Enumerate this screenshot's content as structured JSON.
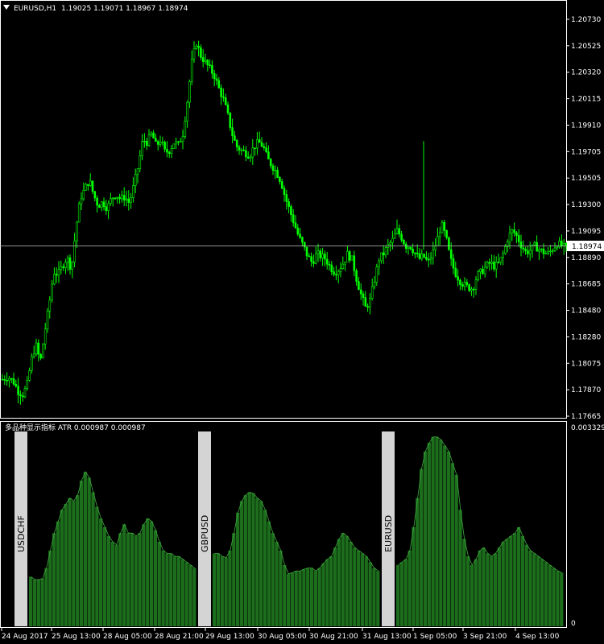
{
  "header": {
    "menu_icon": "triangle-down-icon",
    "symbol_timeframe": "EURUSD,H1",
    "ohlc": "1.19025 1.19071 1.18967 1.18974"
  },
  "colors": {
    "background": "#000000",
    "candle": "#00ff00",
    "price_line": "#c0c0c0",
    "axis": "#ffffff",
    "histogram_fill": "#1c6e1c",
    "histogram_edge": "#3fa83f",
    "symbol_bar": "#d4d4d4"
  },
  "price_axis": {
    "ticks": [
      "1.20730",
      "1.20525",
      "1.20320",
      "1.20115",
      "1.19910",
      "1.19705",
      "1.19505",
      "1.19300",
      "1.19095",
      "1.18890",
      "1.18685",
      "1.18480",
      "1.18280",
      "1.18075",
      "1.17870",
      "1.17665"
    ],
    "current_price": "1.18974"
  },
  "indicator": {
    "title": "多品种显示指标 ATR 0.000987 0.000987",
    "ticks": [
      "0.003329",
      "0"
    ]
  },
  "time_axis": {
    "labels": [
      "24 Aug 2017",
      "25 Aug 13:00",
      "28 Aug 05:00",
      "28 Aug 21:00",
      "29 Aug 13:00",
      "30 Aug 05:00",
      "30 Aug 21:00",
      "31 Aug 13:00",
      "1 Sep 05:00",
      "3 Sep 21:00",
      "4 Sep 13:00"
    ]
  },
  "chart_data": [
    {
      "type": "candlestick",
      "symbol": "EURUSD",
      "timeframe": "H1",
      "ylim": [
        1.17665,
        1.2083
      ],
      "close_path": [
        [
          0,
          1.1795
        ],
        [
          5,
          1.1797
        ],
        [
          10,
          1.1793
        ],
        [
          14,
          1.1786
        ],
        [
          18,
          1.1783
        ],
        [
          22,
          1.179
        ],
        [
          26,
          1.181
        ],
        [
          30,
          1.1822
        ],
        [
          34,
          1.1808
        ],
        [
          38,
          1.1832
        ],
        [
          42,
          1.1853
        ],
        [
          46,
          1.1878
        ],
        [
          50,
          1.1876
        ],
        [
          54,
          1.1883
        ],
        [
          58,
          1.1889
        ],
        [
          62,
          1.188
        ],
        [
          66,
          1.1912
        ],
        [
          70,
          1.1935
        ],
        [
          74,
          1.1942
        ],
        [
          78,
          1.1949
        ],
        [
          82,
          1.1937
        ],
        [
          86,
          1.1929
        ],
        [
          90,
          1.1932
        ],
        [
          94,
          1.1927
        ],
        [
          98,
          1.1935
        ],
        [
          102,
          1.1938
        ],
        [
          106,
          1.1934
        ],
        [
          110,
          1.1936
        ],
        [
          114,
          1.1931
        ],
        [
          118,
          1.1945
        ],
        [
          122,
          1.196
        ],
        [
          126,
          1.198
        ],
        [
          130,
          1.1978
        ],
        [
          134,
          1.1985
        ],
        [
          138,
          1.1975
        ],
        [
          142,
          1.198
        ],
        [
          146,
          1.197
        ],
        [
          150,
          1.1972
        ],
        [
          154,
          1.1978
        ],
        [
          158,
          1.1976
        ],
        [
          162,
          1.1985
        ],
        [
          166,
          1.201
        ],
        [
          170,
          1.204
        ],
        [
          174,
          1.2055
        ],
        [
          178,
          1.2045
        ],
        [
          182,
          1.204
        ],
        [
          186,
          1.2035
        ],
        [
          190,
          1.203
        ],
        [
          194,
          1.202
        ],
        [
          198,
          1.2012
        ],
        [
          202,
          1.2
        ],
        [
          206,
          1.1985
        ],
        [
          210,
          1.1975
        ],
        [
          214,
          1.1972
        ],
        [
          218,
          1.197
        ],
        [
          222,
          1.1968
        ],
        [
          226,
          1.1975
        ],
        [
          230,
          1.1978
        ],
        [
          234,
          1.1975
        ],
        [
          238,
          1.1965
        ],
        [
          242,
          1.196
        ],
        [
          246,
          1.1955
        ],
        [
          250,
          1.1948
        ],
        [
          254,
          1.1935
        ],
        [
          258,
          1.1925
        ],
        [
          262,
          1.1915
        ],
        [
          266,
          1.1905
        ],
        [
          270,
          1.1898
        ],
        [
          274,
          1.189
        ],
        [
          278,
          1.1885
        ],
        [
          282,
          1.1892
        ],
        [
          286,
          1.189
        ],
        [
          290,
          1.1888
        ],
        [
          294,
          1.1882
        ],
        [
          298,
          1.1878
        ],
        [
          302,
          1.188
        ],
        [
          306,
          1.1885
        ],
        [
          310,
          1.1892
        ],
        [
          314,
          1.1887
        ],
        [
          318,
          1.1872
        ],
        [
          322,
          1.186
        ],
        [
          326,
          1.185
        ],
        [
          330,
          1.1856
        ],
        [
          334,
          1.1872
        ],
        [
          338,
          1.1888
        ],
        [
          342,
          1.1892
        ],
        [
          346,
          1.1898
        ],
        [
          350,
          1.1902
        ],
        [
          354,
          1.191
        ],
        [
          358,
          1.1905
        ],
        [
          362,
          1.1898
        ],
        [
          366,
          1.1898
        ],
        [
          370,
          1.1893
        ],
        [
          374,
          1.1888
        ],
        [
          378,
          1.189
        ],
        [
          382,
          1.1885
        ],
        [
          386,
          1.1892
        ],
        [
          390,
          1.1902
        ],
        [
          394,
          1.1915
        ],
        [
          398,
          1.1905
        ],
        [
          402,
          1.1888
        ],
        [
          406,
          1.1878
        ],
        [
          410,
          1.1872
        ],
        [
          414,
          1.1868
        ],
        [
          418,
          1.1866
        ],
        [
          422,
          1.1865
        ],
        [
          426,
          1.1875
        ],
        [
          430,
          1.1878
        ],
        [
          434,
          1.1882
        ],
        [
          438,
          1.1885
        ],
        [
          442,
          1.1882
        ],
        [
          446,
          1.1885
        ],
        [
          450,
          1.1893
        ],
        [
          454,
          1.1905
        ],
        [
          458,
          1.191
        ],
        [
          462,
          1.1905
        ],
        [
          466,
          1.1898
        ],
        [
          470,
          1.1893
        ],
        [
          474,
          1.1895
        ],
        [
          478,
          1.1898
        ],
        [
          482,
          1.1895
        ],
        [
          486,
          1.1893
        ],
        [
          490,
          1.1892
        ],
        [
          494,
          1.1896
        ],
        [
          498,
          1.19
        ],
        [
          502,
          1.1898
        ],
        [
          506,
          1.1896
        ]
      ]
    },
    {
      "type": "bar",
      "indicator": "ATR",
      "ylim": [
        0,
        0.003329
      ],
      "groups": [
        "USDCHF",
        "GBPUSD",
        "EURUSD"
      ],
      "values": [
        [
          0.00085,
          0.0008,
          0.0008,
          0.00082,
          0.001,
          0.0013,
          0.0016,
          0.0018,
          0.002,
          0.0021,
          0.0022,
          0.00215,
          0.00225,
          0.0025,
          0.00265,
          0.00255,
          0.0023,
          0.00205,
          0.00185,
          0.0017,
          0.00155,
          0.00145,
          0.0014,
          0.0016,
          0.00175,
          0.0016,
          0.0016,
          0.00155,
          0.0016,
          0.00175,
          0.00185,
          0.0018,
          0.00165,
          0.00145,
          0.0013,
          0.00125,
          0.00125,
          0.0012,
          0.0012,
          0.00115,
          0.0011,
          0.00105,
          0.001
        ],
        [
          0.00125,
          0.00125,
          0.0012,
          0.00118,
          0.0013,
          0.0016,
          0.00195,
          0.00215,
          0.00225,
          0.0023,
          0.00228,
          0.0022,
          0.00215,
          0.002,
          0.0018,
          0.0016,
          0.00145,
          0.0013,
          0.00105,
          0.0009,
          0.00092,
          0.00095,
          0.00095,
          0.00098,
          0.001,
          0.001,
          0.00095,
          0.001,
          0.00108,
          0.00115,
          0.0012,
          0.00135,
          0.0015,
          0.0016,
          0.00155,
          0.00145,
          0.00135,
          0.0013,
          0.00125,
          0.0012,
          0.0011,
          0.001,
          0.00095
        ],
        [
          0.00105,
          0.0011,
          0.00115,
          0.0013,
          0.0017,
          0.0022,
          0.0027,
          0.003,
          0.00315,
          0.00325,
          0.00325,
          0.0032,
          0.0031,
          0.003,
          0.0028,
          0.0026,
          0.002,
          0.0015,
          0.0012,
          0.00105,
          0.00115,
          0.0013,
          0.00135,
          0.00125,
          0.0012,
          0.00125,
          0.00135,
          0.00145,
          0.0015,
          0.00155,
          0.0016,
          0.0017,
          0.00155,
          0.0014,
          0.0013,
          0.00125,
          0.0012,
          0.00115,
          0.0011,
          0.00105,
          0.001,
          0.00095,
          0.00092
        ]
      ]
    }
  ]
}
